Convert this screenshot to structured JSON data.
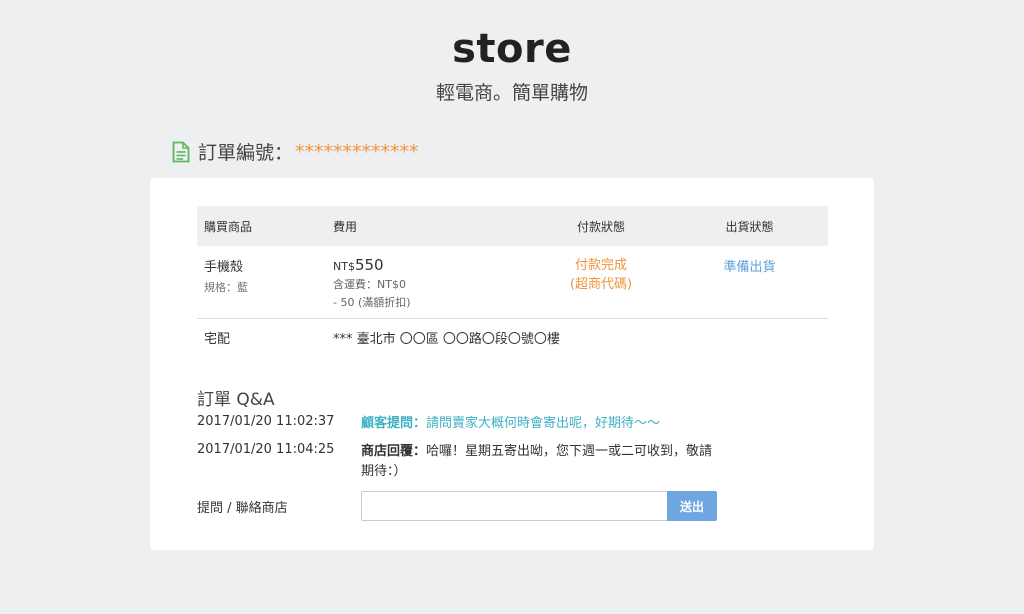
{
  "header": {
    "brand": "store",
    "tagline": "輕電商。簡單購物"
  },
  "order": {
    "title_label": "訂單編號：",
    "number": "*************"
  },
  "table": {
    "headers": [
      "購買商品",
      "費用",
      "付款狀態",
      "出貨狀態"
    ],
    "item": {
      "name": "手機殼",
      "spec": "規格：藍",
      "currency": "NT$",
      "price": "550",
      "shipping": "含運費：NT$0",
      "discount": "- 50 (滿額折扣)",
      "payment_status": "付款完成",
      "payment_method": "(超商代碼)",
      "delivery_status": "準備出貨"
    },
    "shipping_row": {
      "method": "宅配",
      "address": "*** 臺北市 〇〇區 〇〇路〇段〇號〇樓"
    }
  },
  "qa": {
    "title": "訂單 Q&A",
    "entries": [
      {
        "timestamp": "2017/01/20 11:02:37",
        "label": "顧客提問：",
        "text": "請問賣家大概何時會寄出呢，好期待〜〜"
      },
      {
        "timestamp": "2017/01/20 11:04:25",
        "label": "商店回覆：",
        "text": "哈囉！星期五寄出呦，您下週一或二可收到，敬請期待：）"
      }
    ],
    "ask_label": "提問 / 聯絡商店",
    "input_value": "",
    "input_placeholder": "",
    "submit_label": "送出"
  },
  "colors": {
    "background": "#eeeff1",
    "accent_orange": "#f0953a",
    "accent_blue": "#5aa0dd",
    "question_teal": "#3fb0c4",
    "button_blue": "#6fa5e0",
    "icon_green": "#5cb85c"
  },
  "icons": {
    "order_icon": "document-icon"
  }
}
